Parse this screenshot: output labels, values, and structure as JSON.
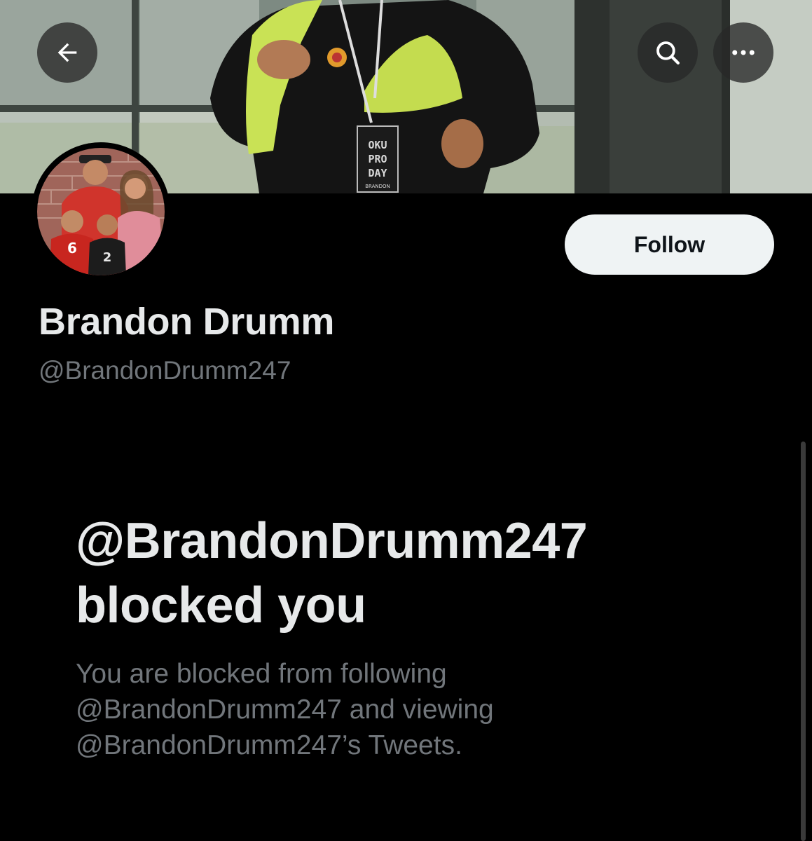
{
  "header": {
    "back_icon": "arrow-left-icon",
    "search_icon": "search-icon",
    "more_icon": "more-horizontal-icon"
  },
  "profile": {
    "display_name": "Brandon Drumm",
    "handle": "@BrandonDrumm247",
    "follow_label": "Follow",
    "banner_badge_text": "OKU PRO DAY BRANDON"
  },
  "blocked": {
    "title_line1": "@BrandonDrumm247",
    "title_line2": "blocked you",
    "desc_line1": "You are blocked from following",
    "desc_line2": "@BrandonDrumm247 and viewing",
    "desc_line3": "@BrandonDrumm247’s Tweets."
  },
  "colors": {
    "background": "#000000",
    "primary_text": "#e7e9ea",
    "secondary_text": "#71767b",
    "follow_bg": "#eff3f4",
    "follow_text": "#0f1419"
  }
}
